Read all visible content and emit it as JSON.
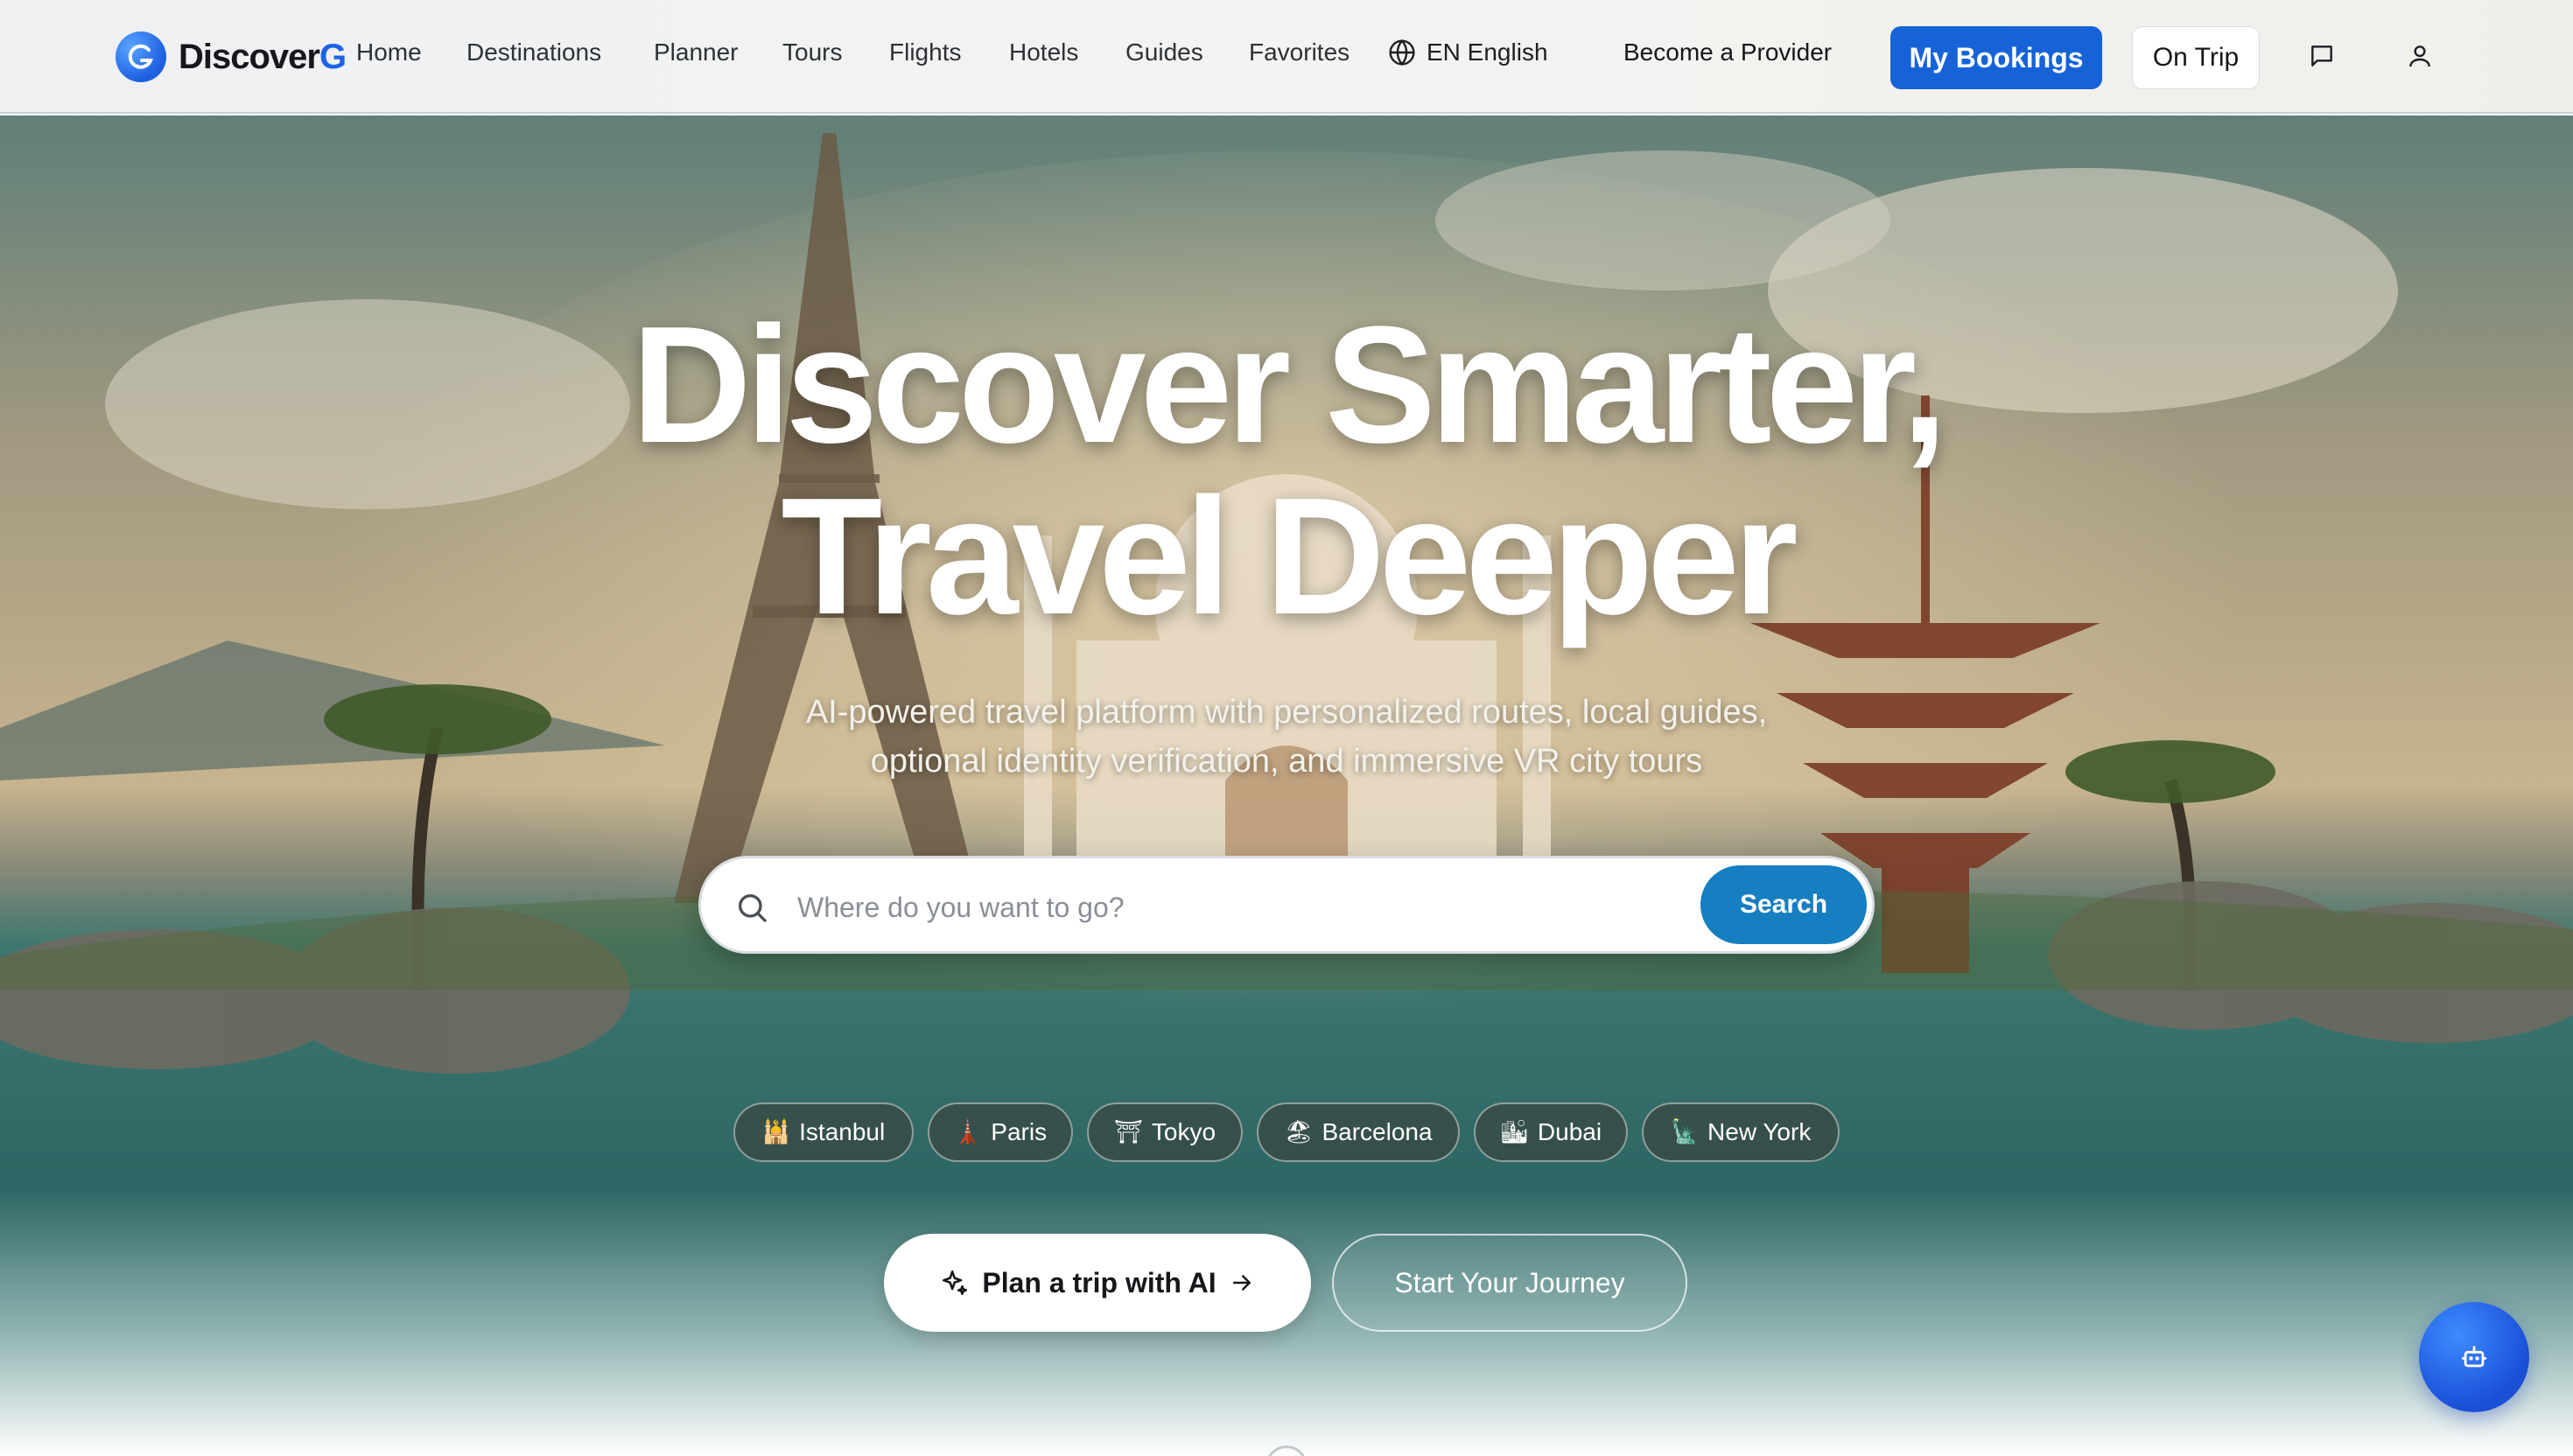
{
  "brand": {
    "name_main": "Discover",
    "name_accent": "G",
    "logo_letter": "G"
  },
  "nav": {
    "items": [
      {
        "label": "Home"
      },
      {
        "label": "Destinations"
      },
      {
        "label": "Planner"
      },
      {
        "label": "Tours"
      },
      {
        "label": "Flights"
      },
      {
        "label": "Hotels"
      },
      {
        "label": "Guides"
      },
      {
        "label": "Favorites"
      }
    ],
    "language": "EN English",
    "become_provider": "Become a Provider",
    "my_bookings": "My Bookings",
    "on_trip": "On Trip",
    "icons": {
      "language": "globe-icon",
      "messages": "message-square-icon",
      "account": "user-icon"
    }
  },
  "hero": {
    "title_line1": "Discover Smarter,",
    "title_line2": "Travel Deeper",
    "subtitle_line1": "AI-powered travel platform with personalized routes, local guides,",
    "subtitle_line2": "optional identity verification, and immersive VR city tours",
    "search": {
      "placeholder": "Where do you want to go?",
      "value": "",
      "button": "Search"
    },
    "quick_destinations": [
      {
        "emoji": "🕌",
        "label": "Istanbul"
      },
      {
        "emoji": "🗼",
        "label": "Paris"
      },
      {
        "emoji": "⛩",
        "label": "Tokyo"
      },
      {
        "emoji": "🏖",
        "label": "Barcelona"
      },
      {
        "emoji": "🏙",
        "label": "Dubai"
      },
      {
        "emoji": "🗽",
        "label": "New York"
      }
    ],
    "cta_primary": "Plan a trip with AI",
    "cta_secondary": "Start Your Journey"
  },
  "colors": {
    "accent": "#1663d8",
    "search_button": "#157fc1",
    "brand_accent": "#1d63e6",
    "chat_button": "#1a4fd6"
  }
}
